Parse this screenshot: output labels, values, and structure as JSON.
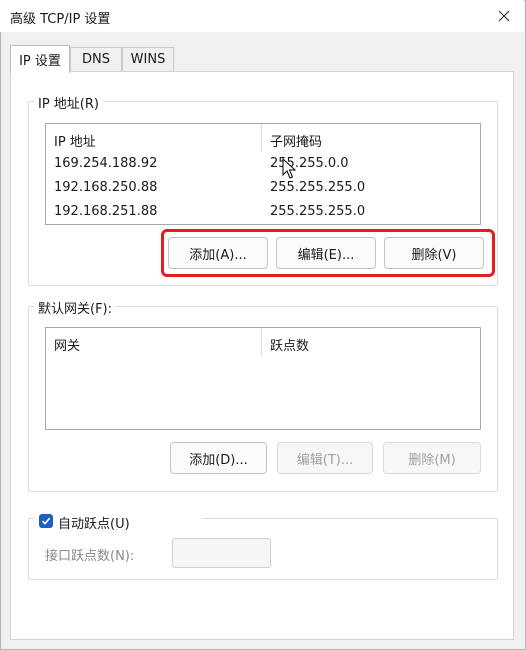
{
  "window": {
    "title": "高级 TCP/IP 设置"
  },
  "tabs": [
    "IP 设置",
    "DNS",
    "WINS"
  ],
  "ip_group": {
    "legend": "IP 地址(R)",
    "headers": [
      "IP 地址",
      "子网掩码"
    ],
    "rows": [
      [
        "169.254.188.92",
        "255.255.0.0"
      ],
      [
        "192.168.250.88",
        "255.255.255.0"
      ],
      [
        "192.168.251.88",
        "255.255.255.0"
      ]
    ],
    "buttons": {
      "add": "添加(A)...",
      "edit": "编辑(E)...",
      "delete": "删除(V)"
    }
  },
  "gateway_group": {
    "legend": "默认网关(F):",
    "headers": [
      "网关",
      "跃点数"
    ],
    "buttons": {
      "add": "添加(D)...",
      "edit": "编辑(T)...",
      "delete": "删除(M)"
    }
  },
  "metric": {
    "auto_label": "自动跃点(U)",
    "auto_checked": true,
    "interface_label": "接口跃点数(N):",
    "interface_value": ""
  },
  "colors": {
    "highlight": "#e51c24",
    "checkbox": "#1f5fbf"
  }
}
